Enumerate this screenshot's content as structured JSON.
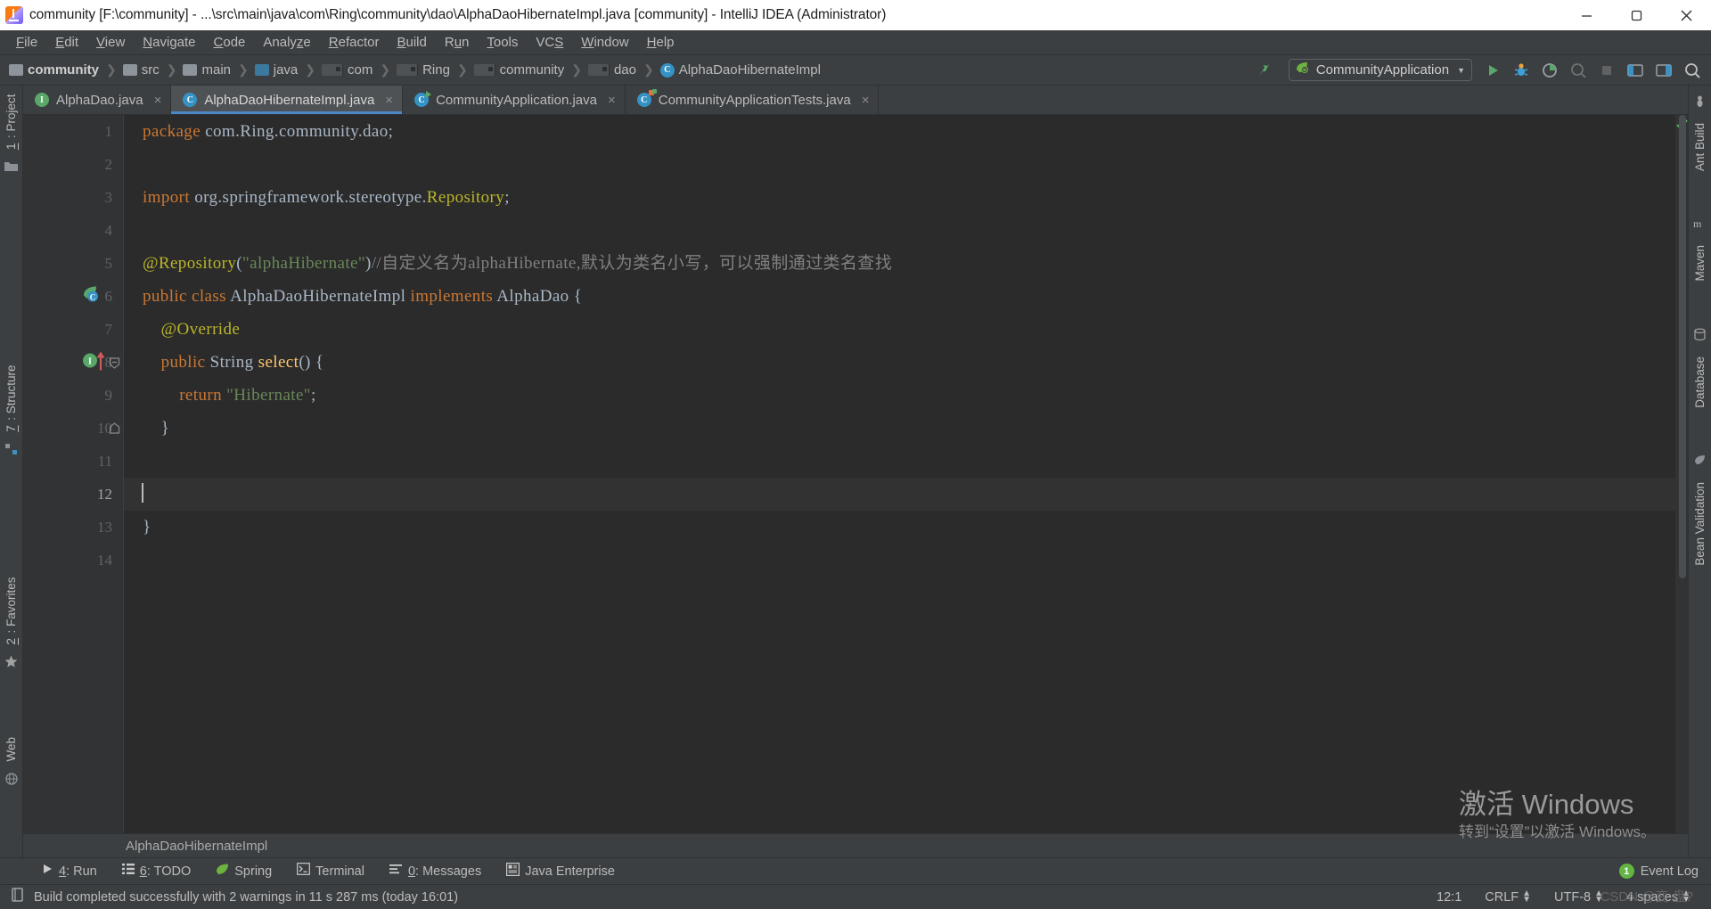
{
  "window": {
    "title": "community [F:\\community] - ...\\src\\main\\java\\com\\Ring\\community\\dao\\AlphaDaoHibernateImpl.java [community] - IntelliJ IDEA (Administrator)",
    "minimize": "minimize-icon",
    "maximize": "maximize-icon",
    "close": "close-icon"
  },
  "menu": [
    {
      "label": "File",
      "mnemonic": "F"
    },
    {
      "label": "Edit",
      "mnemonic": "E"
    },
    {
      "label": "View",
      "mnemonic": "V"
    },
    {
      "label": "Navigate",
      "mnemonic": "N"
    },
    {
      "label": "Code",
      "mnemonic": "C"
    },
    {
      "label": "Analyze",
      "mnemonic": "z"
    },
    {
      "label": "Refactor",
      "mnemonic": "R"
    },
    {
      "label": "Build",
      "mnemonic": "B"
    },
    {
      "label": "Run",
      "mnemonic": "u"
    },
    {
      "label": "Tools",
      "mnemonic": "T"
    },
    {
      "label": "VCS",
      "mnemonic": "S"
    },
    {
      "label": "Window",
      "mnemonic": "W"
    },
    {
      "label": "Help",
      "mnemonic": "H"
    }
  ],
  "breadcrumb": [
    {
      "label": "community",
      "icon": "folder-icon"
    },
    {
      "label": "src",
      "icon": "folder-icon"
    },
    {
      "label": "main",
      "icon": "folder-icon"
    },
    {
      "label": "java",
      "icon": "folder-source-icon"
    },
    {
      "label": "com",
      "icon": "package-icon"
    },
    {
      "label": "Ring",
      "icon": "package-icon"
    },
    {
      "label": "community",
      "icon": "package-icon"
    },
    {
      "label": "dao",
      "icon": "package-icon"
    },
    {
      "label": "AlphaDaoHibernateImpl",
      "icon": "class-icon"
    }
  ],
  "toolbar": {
    "run_configuration": "CommunityApplication",
    "buttons": [
      "build-icon",
      "run-icon",
      "debug-icon",
      "run-coverage-icon",
      "profile-icon",
      "stop-icon",
      "update-icon",
      "layout-icon",
      "search-icon"
    ]
  },
  "tabs": [
    {
      "label": "AlphaDao.java",
      "icon": "interface-icon",
      "active": false,
      "close": "×"
    },
    {
      "label": "AlphaDaoHibernateImpl.java",
      "icon": "class-icon",
      "active": true,
      "close": "×"
    },
    {
      "label": "CommunityApplication.java",
      "icon": "spring-class-icon",
      "active": false,
      "close": "×"
    },
    {
      "label": "CommunityApplicationTests.java",
      "icon": "test-class-icon",
      "active": false,
      "close": "×"
    }
  ],
  "left_strip": [
    {
      "label": "1: Project",
      "mnemonic": "1"
    },
    {
      "label": "1: Structure",
      "mnemonic": "7"
    },
    {
      "label": "2: Favorites",
      "mnemonic": "2"
    },
    {
      "label": "Web",
      "mnemonic": ""
    }
  ],
  "right_strip": [
    {
      "label": "Ant Build"
    },
    {
      "label": "Maven"
    },
    {
      "label": "Database"
    },
    {
      "label": "Bean Validation"
    }
  ],
  "editor": {
    "line_numbers": [
      "1",
      "2",
      "3",
      "4",
      "5",
      "6",
      "7",
      "8",
      "9",
      "10",
      "11",
      "12",
      "13",
      "14"
    ],
    "current_line": 12,
    "lines": [
      {
        "n": 1,
        "tokens": [
          {
            "t": "package",
            "c": "kw"
          },
          {
            "t": " com.Ring.community.dao;",
            "c": "pl"
          }
        ]
      },
      {
        "n": 2,
        "tokens": []
      },
      {
        "n": 3,
        "tokens": [
          {
            "t": "import",
            "c": "kw"
          },
          {
            "t": " org.springframework.stereotype.",
            "c": "pl"
          },
          {
            "t": "Repository",
            "c": "ann"
          },
          {
            "t": ";",
            "c": "pl"
          }
        ]
      },
      {
        "n": 4,
        "tokens": []
      },
      {
        "n": 5,
        "tokens": [
          {
            "t": "@Repository",
            "c": "ann"
          },
          {
            "t": "(",
            "c": "pl"
          },
          {
            "t": "\"alphaHibernate\"",
            "c": "str"
          },
          {
            "t": ")",
            "c": "pl"
          },
          {
            "t": "//自定义名为alphaHibernate,默认为类名小写，可以强制通过类名查找",
            "c": "cm"
          }
        ]
      },
      {
        "n": 6,
        "tokens": [
          {
            "t": "public class",
            "c": "kw"
          },
          {
            "t": " AlphaDaoHibernateImpl ",
            "c": "pl"
          },
          {
            "t": "implements",
            "c": "kw"
          },
          {
            "t": " AlphaDao {",
            "c": "pl"
          }
        ]
      },
      {
        "n": 7,
        "tokens": [
          {
            "t": "    @Override",
            "c": "ann"
          }
        ]
      },
      {
        "n": 8,
        "tokens": [
          {
            "t": "    public",
            "c": "kw"
          },
          {
            "t": " String ",
            "c": "pl"
          },
          {
            "t": "select",
            "c": "mth"
          },
          {
            "t": "() {",
            "c": "pl"
          }
        ]
      },
      {
        "n": 9,
        "tokens": [
          {
            "t": "        return",
            "c": "kw"
          },
          {
            "t": " ",
            "c": "pl"
          },
          {
            "t": "\"Hibernate\"",
            "c": "str"
          },
          {
            "t": ";",
            "c": "pl"
          }
        ]
      },
      {
        "n": 10,
        "tokens": [
          {
            "t": "    }",
            "c": "pl"
          }
        ]
      },
      {
        "n": 11,
        "tokens": []
      },
      {
        "n": 12,
        "tokens": []
      },
      {
        "n": 13,
        "tokens": [
          {
            "t": "}",
            "c": "pl"
          }
        ]
      },
      {
        "n": 14,
        "tokens": []
      }
    ],
    "gutter_marks": [
      {
        "line": 6,
        "icon": "spring-bean-icon"
      },
      {
        "line": 8,
        "icon": "implementing-method-icon"
      }
    ],
    "breadcrumb_bottom": "AlphaDaoHibernateImpl",
    "inspection_status": "no-errors-check-icon"
  },
  "bottom_tools": [
    {
      "label": "4: Run",
      "mnemonic": "4",
      "icon": "run-icon"
    },
    {
      "label": "6: TODO",
      "mnemonic": "6",
      "icon": "todo-icon"
    },
    {
      "label": "Spring",
      "mnemonic": "",
      "icon": "spring-leaf-icon"
    },
    {
      "label": "Terminal",
      "mnemonic": "",
      "icon": "terminal-icon"
    },
    {
      "label": "0: Messages",
      "mnemonic": "0",
      "icon": "messages-icon"
    },
    {
      "label": "Java Enterprise",
      "mnemonic": "",
      "icon": "java-enterprise-icon"
    }
  ],
  "event_log": {
    "label": "Event Log",
    "badge": "1"
  },
  "status": {
    "message": "Build completed successfully with 2 warnings in 11 s 287 ms (today 16:01)",
    "icon": "build-status-icon",
    "caret_position": "12:1",
    "line_separator": "CRLF",
    "encoding": "UTF-8",
    "indent": "4 spaces"
  },
  "watermark": {
    "line1": "激活 Windows",
    "line2": "转到“设置”以激活 Windows。"
  },
  "csdn": "CSDN @变 盘?",
  "colors": {
    "chrome": "#3c3f41",
    "editor_bg": "#2b2b2b",
    "gutter_bg": "#313335",
    "tab_active": "#4e5254",
    "accent": "#4a88c7",
    "keyword": "#cc7832",
    "string": "#6a8759",
    "annotation": "#bbb529",
    "comment": "#808080",
    "method": "#ffc66d",
    "plain": "#a9b7c6"
  }
}
